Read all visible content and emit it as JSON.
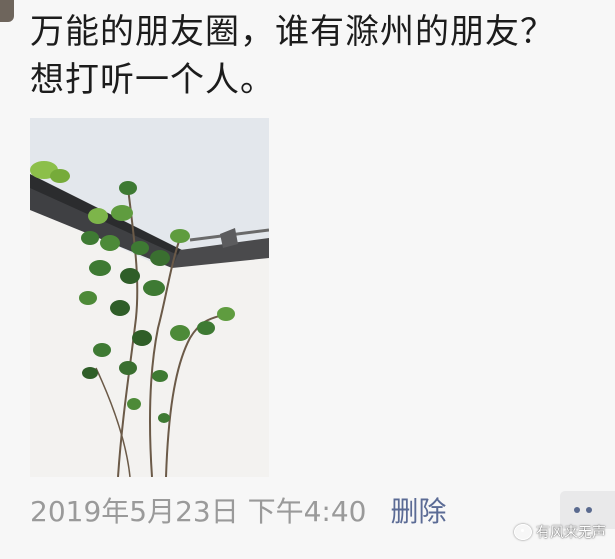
{
  "post": {
    "text_line1": "万能的朋友圈，谁有滁州的朋友？",
    "text_line2": "想打听一个人。",
    "image_alt": "plant-against-white-wall-photo",
    "timestamp": "2019年5月23日 下午4:40",
    "delete_label": "删除"
  },
  "watermark": {
    "text": "有风来无声"
  },
  "colors": {
    "link": "#5b6b95",
    "meta": "#9a9a9a",
    "text": "#1c1c1c",
    "background": "#f7f7f7"
  }
}
